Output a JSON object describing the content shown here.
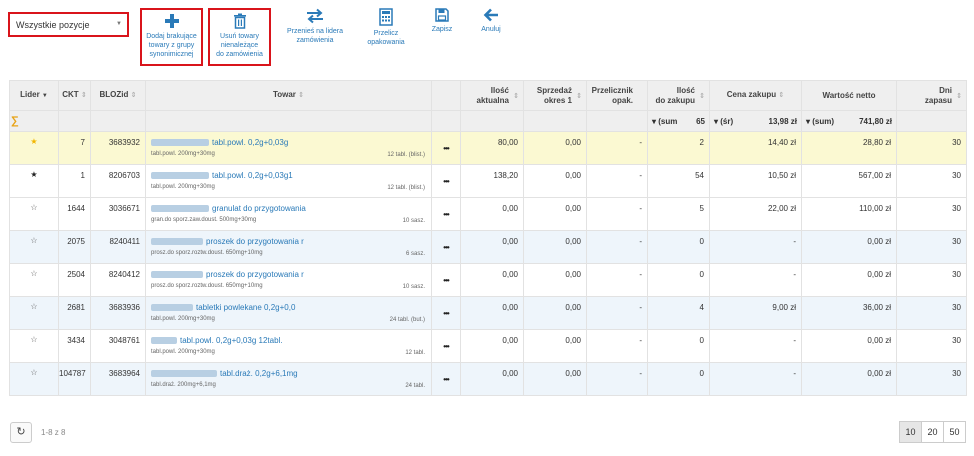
{
  "filter": {
    "selected": "Wszystkie pozycje"
  },
  "toolbar": {
    "add_label_1": "Dodaj brakujące",
    "add_label_2": "towary z grupy",
    "add_label_3": "synonimicznej",
    "remove_label_1": "Usuń towary",
    "remove_label_2": "nienależące",
    "remove_label_3": "do zamówienia",
    "move_label_1": "Przenieś na lidera",
    "move_label_2": "zamówienia",
    "calc_label_1": "Przelicz",
    "calc_label_2": "opakowania",
    "save_label": "Zapisz",
    "cancel_label": "Anuluj",
    "accent_color": "#2a7ab8",
    "highlight_color": "#d9141b"
  },
  "table": {
    "headers": {
      "lider": "Lider",
      "ckt": "CKT",
      "blozid": "BLOZid",
      "towar": "Towar",
      "ilosc_aktualna_1": "Ilość",
      "ilosc_aktualna_2": "aktualna",
      "sprzedaz_1": "Sprzedaż",
      "sprzedaz_2": "okres 1",
      "przelicznik_1": "Przelicznik",
      "przelicznik_2": "opak.",
      "ilosc_zakupu_1": "Ilość",
      "ilosc_zakupu_2": "do zakupu",
      "cena_zakupu": "Cena zakupu",
      "wartosc_netto": "Wartość netto",
      "dni_zapasu_1": "Dni",
      "dni_zapasu_2": "zapasu"
    },
    "summary": {
      "sigma": "∑",
      "ilosc_agg": "▾ (sum",
      "ilosc_val": "65",
      "cena_agg": "▾ (śr)",
      "cena_val": "13,98 zł",
      "wartosc_agg": "▾ (sum)",
      "wartosc_val": "741,80 zł"
    },
    "rows": [
      {
        "star": "★",
        "ckt": "7",
        "bloz": "3683932",
        "name": "tabl.powl. 0,2g+0,03g",
        "sub": "tabl.powl. 200mg+30mg",
        "pack": "12 tabl. (blist.)",
        "ilosc": "80,00",
        "sprzedaz": "0,00",
        "przel": "-",
        "zakup": "2",
        "cena": "14,40 zł",
        "wartosc": "28,80 zł",
        "dni": "30"
      },
      {
        "star": "★",
        "ckt": "1",
        "bloz": "8206703",
        "name": "tabl.powl. 0,2g+0,03g1",
        "sub": "tabl.powl. 200mg+30mg",
        "pack": "12 tabl. (blist.)",
        "ilosc": "138,20",
        "sprzedaz": "0,00",
        "przel": "-",
        "zakup": "54",
        "cena": "10,50 zł",
        "wartosc": "567,00 zł",
        "dni": "30"
      },
      {
        "star": "☆",
        "ckt": "1644",
        "bloz": "3036671",
        "name": "granulat do przygotowania",
        "sub": "gran.do sporz.zaw.doust. 500mg+30mg",
        "pack": "10 sasz.",
        "ilosc": "0,00",
        "sprzedaz": "0,00",
        "przel": "-",
        "zakup": "5",
        "cena": "22,00 zł",
        "wartosc": "110,00 zł",
        "dni": "30"
      },
      {
        "star": "☆",
        "ckt": "2075",
        "bloz": "8240411",
        "name": "proszek do przygotowania r",
        "sub": "prosz.do sporz.roztw.doust. 650mg+10mg",
        "pack": "6 sasz.",
        "ilosc": "0,00",
        "sprzedaz": "0,00",
        "przel": "-",
        "zakup": "0",
        "cena": "-",
        "wartosc": "0,00 zł",
        "dni": "30"
      },
      {
        "star": "☆",
        "ckt": "2504",
        "bloz": "8240412",
        "name": "proszek do przygotowania r",
        "sub": "prosz.do sporz.roztw.doust. 650mg+10mg",
        "pack": "10 sasz.",
        "ilosc": "0,00",
        "sprzedaz": "0,00",
        "przel": "-",
        "zakup": "0",
        "cena": "-",
        "wartosc": "0,00 zł",
        "dni": "30"
      },
      {
        "star": "☆",
        "ckt": "2681",
        "bloz": "3683936",
        "name": "tabletki powlekane 0,2g+0,0",
        "sub": "tabl.powl. 200mg+30mg",
        "pack": "24 tabl. (but.)",
        "ilosc": "0,00",
        "sprzedaz": "0,00",
        "przel": "-",
        "zakup": "4",
        "cena": "9,00 zł",
        "wartosc": "36,00 zł",
        "dni": "30"
      },
      {
        "star": "☆",
        "ckt": "3434",
        "bloz": "3048761",
        "name": "tabl.powl. 0,2g+0,03g 12tabl.",
        "sub": "tabl.powl. 200mg+30mg",
        "pack": "12 tabl.",
        "ilosc": "0,00",
        "sprzedaz": "0,00",
        "przel": "-",
        "zakup": "0",
        "cena": "-",
        "wartosc": "0,00 zł",
        "dni": "30"
      },
      {
        "star": "☆",
        "ckt": "104787",
        "bloz": "3683964",
        "name": "tabl.draż. 0,2g+6,1mg",
        "sub": "tabl.draż. 200mg+6,1mg",
        "pack": "24 tabl.",
        "ilosc": "0,00",
        "sprzedaz": "0,00",
        "przel": "-",
        "zakup": "0",
        "cena": "-",
        "wartosc": "0,00 zł",
        "dni": "30"
      }
    ],
    "more_label": "•••"
  },
  "footer": {
    "refresh_icon": "↻",
    "range": "1-8 z 8",
    "page_sizes": [
      "10",
      "20",
      "50"
    ],
    "active_page_size": "10"
  }
}
